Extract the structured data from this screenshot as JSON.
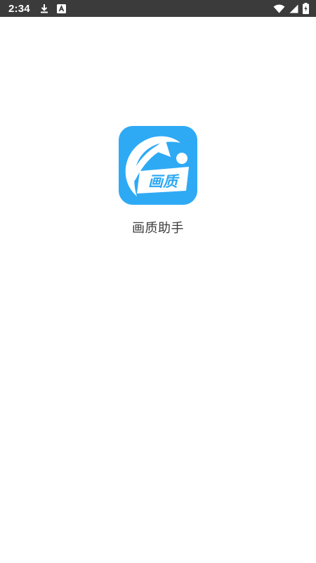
{
  "status_bar": {
    "time": "2:34",
    "left_icons": [
      "download-icon",
      "notification-a-icon"
    ],
    "right_icons": [
      "wifi-icon",
      "signal-icon",
      "battery-charging-icon"
    ],
    "background": "#3b3b3b"
  },
  "splash": {
    "app_name": "画质助手",
    "icon_text": "画质",
    "icon_color": "#2eaaf5"
  }
}
